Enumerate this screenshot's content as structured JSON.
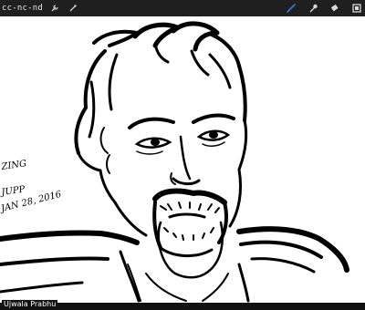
{
  "toolbar": {
    "license": "cc-nc-nd",
    "left_icons": [
      "wrench-icon",
      "wand-icon"
    ],
    "right_icons": [
      "brush-icon",
      "smudge-icon",
      "eraser-icon",
      "layers-icon"
    ],
    "active_tool": "brush",
    "active_color": "#3b78d8"
  },
  "canvas": {
    "margin_note_lines": [
      "ZING",
      "JUPP",
      "JAN 28, 2016"
    ]
  },
  "footer": {
    "credit": "Ujwala Prabhu"
  }
}
